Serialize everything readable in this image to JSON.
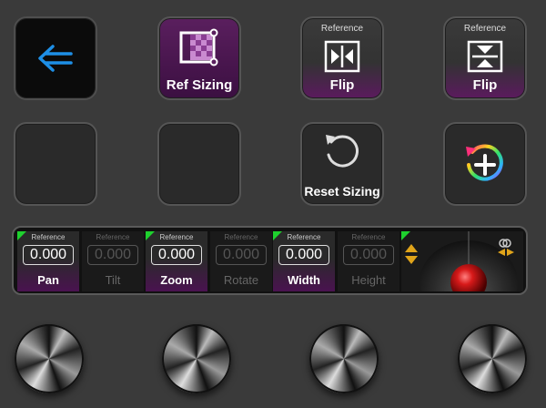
{
  "keys": {
    "back": {
      "icon": "arrow-left-icon",
      "color": "#1e8fe6"
    },
    "ref_sizing": {
      "label": "Ref Sizing",
      "icon": "ref-sizing-icon"
    },
    "flip_h": {
      "small": "Reference",
      "label": "Flip",
      "icon": "flip-horizontal-icon"
    },
    "flip_v": {
      "small": "Reference",
      "label": "Flip",
      "icon": "flip-vertical-icon"
    },
    "reset": {
      "label": "Reset Sizing",
      "icon": "reset-icon"
    },
    "add": {
      "icon": "add-circle-rainbow-icon"
    }
  },
  "params": [
    {
      "ref": "Reference",
      "value": "0.000",
      "name": "Pan",
      "active": true
    },
    {
      "ref": "Reference",
      "value": "0.000",
      "name": "Tilt",
      "active": false
    },
    {
      "ref": "Reference",
      "value": "0.000",
      "name": "Zoom",
      "active": true
    },
    {
      "ref": "Reference",
      "value": "0.000",
      "name": "Rotate",
      "active": false
    },
    {
      "ref": "Reference",
      "value": "0.000",
      "name": "Width",
      "active": true
    },
    {
      "ref": "Reference",
      "value": "0.000",
      "name": "Height",
      "active": false
    }
  ],
  "colors": {
    "accent_green": "#1ed12e",
    "accent_gold": "#e0a41a",
    "purple": "#5b1a5e"
  }
}
